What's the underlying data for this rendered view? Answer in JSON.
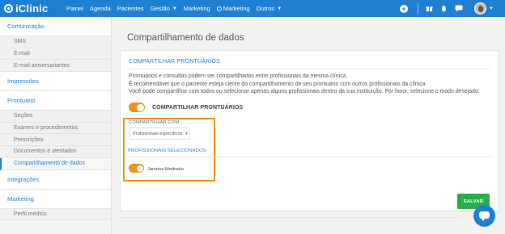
{
  "brand": {
    "name": "iClinic"
  },
  "topnav": {
    "items": [
      {
        "label": "Painel"
      },
      {
        "label": "Agenda"
      },
      {
        "label": "Pacientes"
      },
      {
        "label": "Gestão",
        "has_caret": true
      },
      {
        "label": "Marketing"
      },
      {
        "label": "Marketing",
        "icon": "marketing-circle-icon"
      },
      {
        "label": "Outros",
        "has_caret": true
      }
    ],
    "icons": [
      "add-circle-icon",
      "gift-icon",
      "bell-icon",
      "chat-icon"
    ]
  },
  "sidebar": {
    "sections": [
      {
        "label": "Comunicação",
        "items": [
          "SMS",
          "E-mail",
          "E-mail aniversariantes"
        ]
      },
      {
        "label": "Impressões",
        "items": []
      },
      {
        "label": "Prontuário",
        "items": [
          "Seções",
          "Exames e procedimentos",
          "Prescrições",
          "Documentos e atestados",
          "Compartilhamento de dados"
        ]
      },
      {
        "label": "Integrações",
        "items": []
      },
      {
        "label": "Marketing",
        "items": [
          "Perfil médico"
        ]
      }
    ],
    "active_item": "Compartilhamento de dados"
  },
  "page": {
    "title": "Compartilhamento de dados",
    "card_heading": "COMPARTILHAR PRONTUÁRIOS",
    "description": [
      "Prontuários e consultas podem ser compartilhadas entre profissionais da mesma clínica.",
      "É recomendável que o paciente esteja ciente do compartilhamento de seu prontuário com outros profissionais da clínica.",
      "Você pode compartilhar com todos ou selecionar apenas alguns profissionais dentro da sua instituição. Por favor, selecione o modo desejado:"
    ],
    "share_toggle": {
      "label": "COMPARTILHAR PRONTUÁRIOS",
      "on": true
    },
    "share_with": {
      "label": "COMPARTILHAR COM:",
      "value": "Profissionais específicos"
    },
    "selected_heading": "PROFISSIONAIS SELECIONADOS",
    "professionals": [
      {
        "name": "Janaina Medrado",
        "on": true
      }
    ],
    "save_label": "SALVAR"
  },
  "colors": {
    "primary": "#1e7fd3",
    "accent": "#f0921c",
    "success": "#27ae4a"
  }
}
